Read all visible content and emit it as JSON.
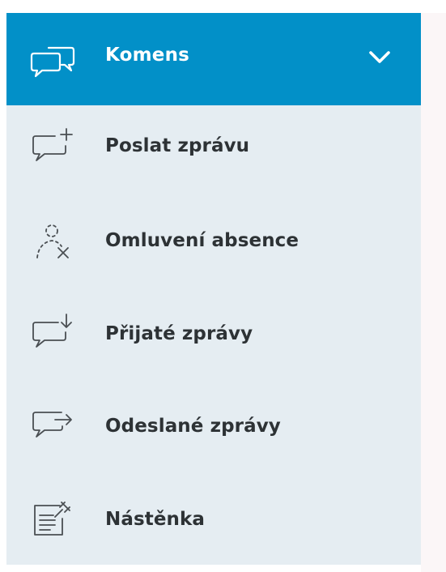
{
  "menu": {
    "header": {
      "label": "Komens",
      "icon": "chat-bubbles-icon",
      "expand_icon": "chevron-down-icon"
    },
    "items": [
      {
        "label": "Poslat zprávu",
        "icon": "new-message-icon"
      },
      {
        "label": "Omluvení absence",
        "icon": "absence-excuse-icon"
      },
      {
        "label": "Přijaté zprávy",
        "icon": "received-messages-icon"
      },
      {
        "label": "Odeslané zprávy",
        "icon": "sent-messages-icon"
      },
      {
        "label": "Nástěnka",
        "icon": "noticeboard-pin-icon"
      }
    ]
  },
  "colors": {
    "header_bg": "#0290c8",
    "sidebar_bg": "#e5edf2",
    "text": "#2d3235",
    "icon_stroke": "#4a4f53"
  }
}
